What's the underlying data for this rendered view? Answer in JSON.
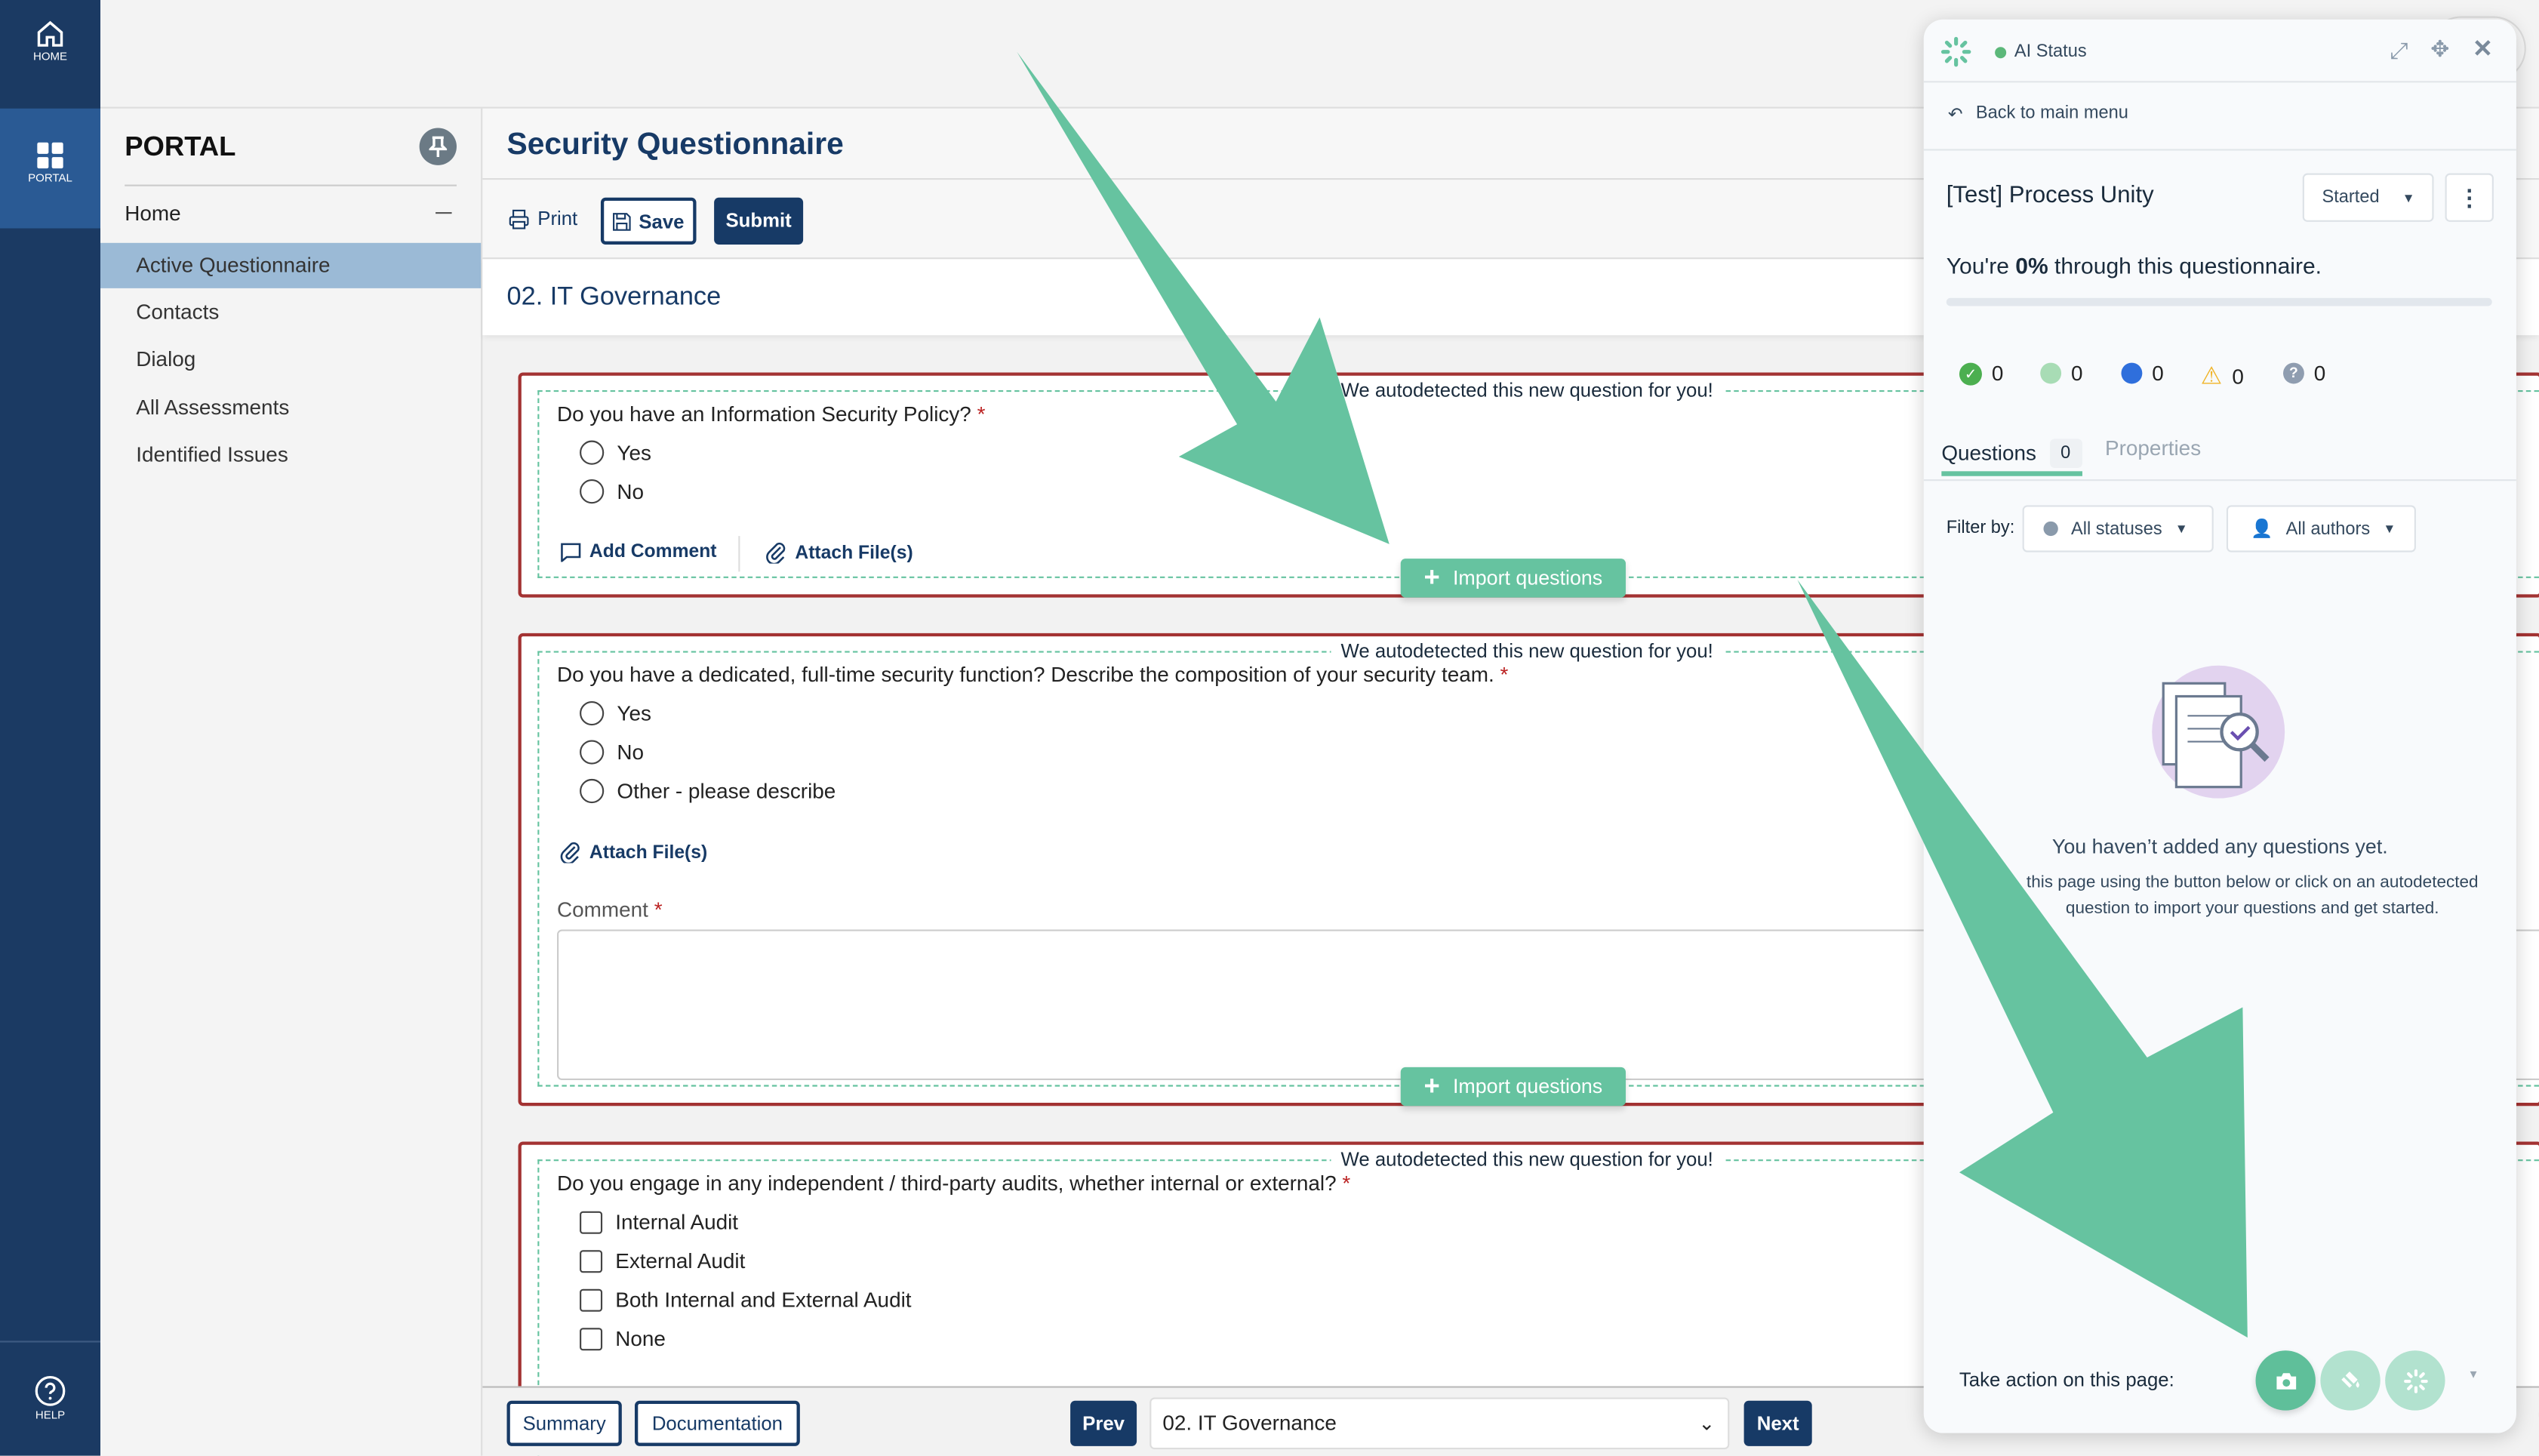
{
  "rail": {
    "home": "HOME",
    "portal": "PORTAL",
    "help": "HELP"
  },
  "sidebar": {
    "title": "PORTAL",
    "home": "Home",
    "items": [
      {
        "label": "Active Questionnaire",
        "active": true
      },
      {
        "label": "Contacts"
      },
      {
        "label": "Dialog"
      },
      {
        "label": "All Assessments"
      },
      {
        "label": "Identified Issues"
      }
    ]
  },
  "header": {
    "title": "Security Questionnaire",
    "print": "Print",
    "save": "Save",
    "submit": "Submit",
    "section": "02. IT Governance"
  },
  "autodetect_label": "We autodetected this new question for you!",
  "import_label": "Import questions",
  "questions": [
    {
      "text": "Do you have an Information Security Policy?",
      "required": "*",
      "options": [
        "Yes",
        "No"
      ],
      "add_comment": "Add Comment",
      "attach": "Attach File(s)"
    },
    {
      "text": "Do you have a dedicated, full-time security function? Describe the composition of your security team.",
      "required": "*",
      "options": [
        "Yes",
        "No",
        "Other - please describe"
      ],
      "attach": "Attach File(s)",
      "comment_label": "Comment",
      "comment_value": ""
    },
    {
      "text": "Do you engage in any independent / third-party audits, whether internal or external?",
      "required": "*",
      "options": [
        "Internal Audit",
        "External Audit",
        "Both Internal and External Audit",
        "None"
      ]
    }
  ],
  "footer": {
    "summary": "Summary",
    "documentation": "Documentation",
    "prev": "Prev",
    "section_select": "02. IT Governance",
    "next": "Next"
  },
  "panel": {
    "status": "AI Status",
    "status_color": "#5cb87a",
    "back": "Back to main menu",
    "title": "[Test] Process Unity",
    "state": "Started",
    "progress_prefix": "You're ",
    "progress_value": "0%",
    "progress_suffix": " through this questionnaire.",
    "progress_fraction": 0,
    "counts": [
      {
        "icon": "check-circle",
        "value": "0",
        "color": "#4caf50"
      },
      {
        "icon": "light-green-dot",
        "value": "0",
        "color": "#a8dcb5"
      },
      {
        "icon": "blue-dot",
        "value": "0",
        "color": "#2f6fdc"
      },
      {
        "icon": "warning",
        "value": "0",
        "color": "#f0b429"
      },
      {
        "icon": "question-circle",
        "value": "0",
        "color": "#8f9db0"
      }
    ],
    "tabs": [
      {
        "label": "Questions",
        "count": "0",
        "active": true
      },
      {
        "label": "Properties"
      }
    ],
    "filter_label": "Filter by:",
    "statuses": "All statuses",
    "authors": "All authors",
    "empty_title": "You haven’t added any questions yet.",
    "empty_line1": "this page using the button below or click on an autodetected",
    "empty_line2": "question to import your questions and get started.",
    "take_action": "Take action on this page:"
  },
  "accent": "#66c3a0"
}
